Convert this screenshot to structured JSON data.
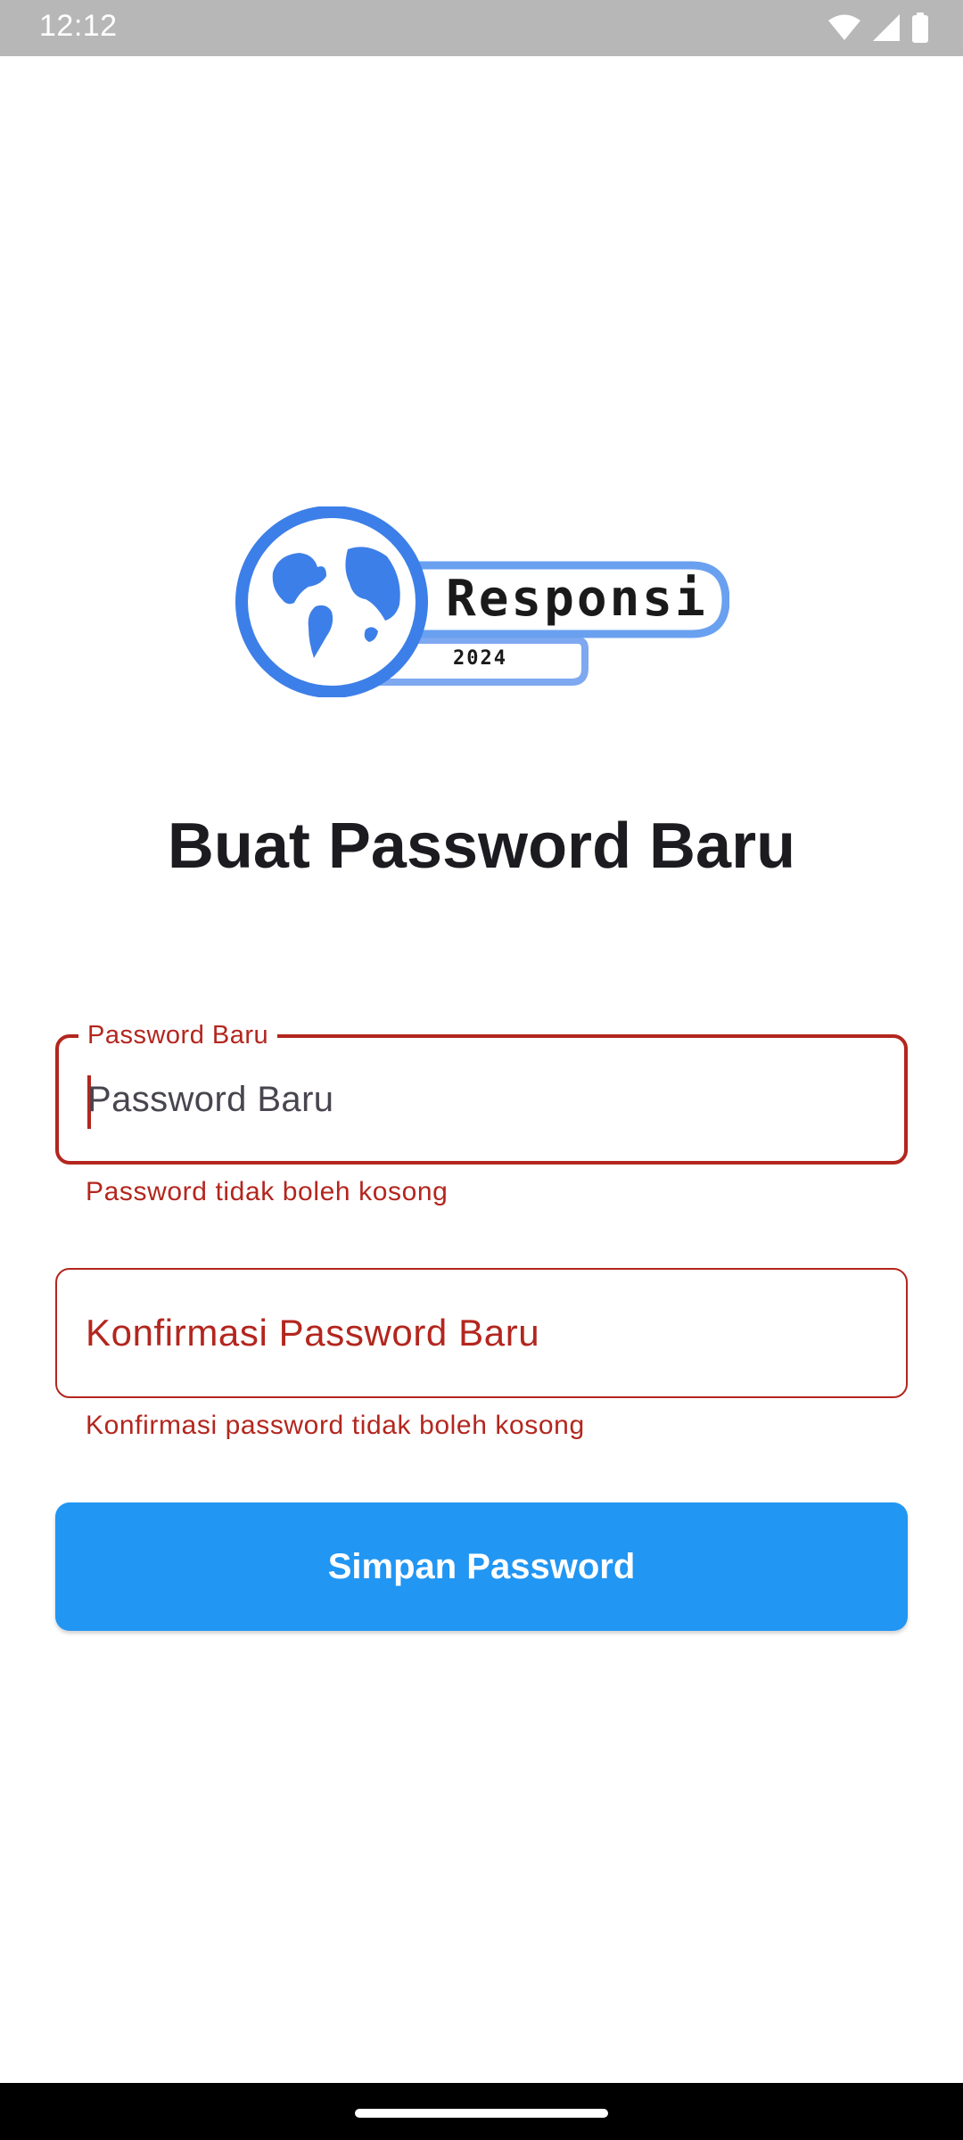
{
  "status_bar": {
    "time": "12:12",
    "icons": [
      "wifi-icon",
      "cell-signal-icon",
      "battery-icon"
    ]
  },
  "logo": {
    "word": "Responsi",
    "year": "2024",
    "brand_color": "#4285f4"
  },
  "page": {
    "title": "Buat Password Baru"
  },
  "form": {
    "new_password": {
      "floating_label": "Password Baru",
      "value": "",
      "placeholder": "Password Baru",
      "error": "Password tidak boleh kosong",
      "focused": true
    },
    "confirm_password": {
      "label": "Konfirmasi Password Baru",
      "value": "",
      "error": "Konfirmasi password tidak boleh kosong",
      "focused": false
    },
    "submit_label": "Simpan Password"
  },
  "colors": {
    "error": "#b3261e",
    "primary_button": "#2196f3",
    "status_bar": "#b7b7b7"
  }
}
